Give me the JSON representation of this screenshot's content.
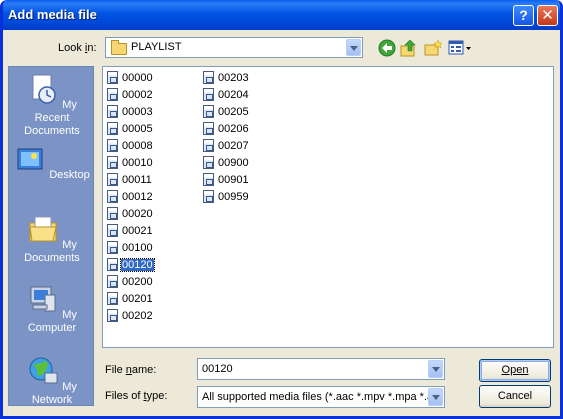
{
  "window": {
    "title": "Add media file",
    "help_btn": "?",
    "close_btn": "✕"
  },
  "lookin": {
    "label": "Look in:",
    "value": "PLAYLIST"
  },
  "places": [
    {
      "label": "My Recent Documents",
      "icon": "recent-documents-icon"
    },
    {
      "label": "Desktop",
      "icon": "desktop-icon"
    },
    {
      "label": "My Documents",
      "icon": "my-documents-icon"
    },
    {
      "label": "My Computer",
      "icon": "my-computer-icon"
    },
    {
      "label": "My Network",
      "icon": "my-network-icon"
    }
  ],
  "files_col1": [
    "00000",
    "00002",
    "00003",
    "00005",
    "00008",
    "00010",
    "00011",
    "00012",
    "00020",
    "00021",
    "00100",
    "00120",
    "00200",
    "00201",
    "00202"
  ],
  "files_col2": [
    "00203",
    "00204",
    "00205",
    "00206",
    "00207",
    "00900",
    "00901",
    "00959"
  ],
  "selected_file": "00120",
  "filename": {
    "label": "File name:",
    "value": "00120"
  },
  "filetype": {
    "label": "Files of type:",
    "value": "All supported media files (*.aac *.mpv *.mpa *.a"
  },
  "buttons": {
    "open": "Open",
    "cancel": "Cancel"
  }
}
